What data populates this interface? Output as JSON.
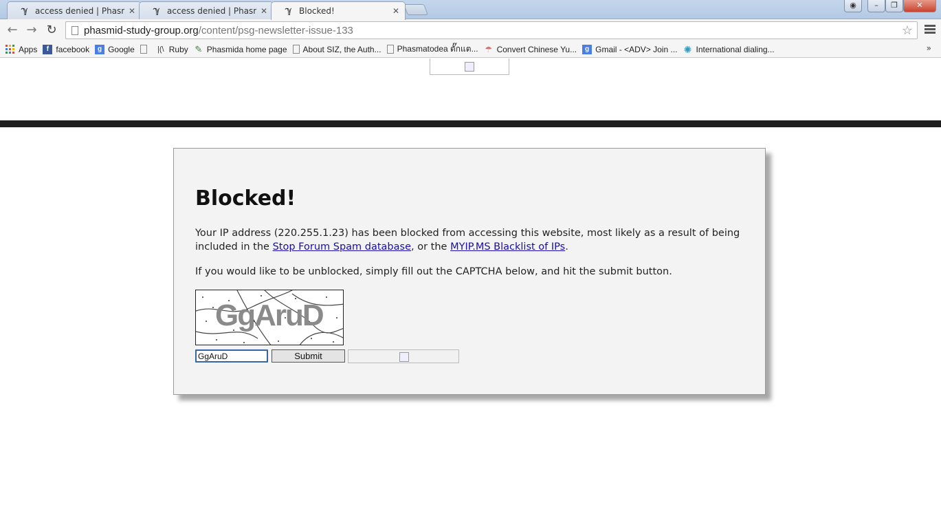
{
  "browser": {
    "tabs": [
      {
        "title": "access denied | Phasmid S",
        "favicon": "fern-icon",
        "active": false
      },
      {
        "title": "access denied | Phasmid S",
        "favicon": "fern-icon",
        "active": false
      },
      {
        "title": "Blocked!",
        "favicon": "fern-icon",
        "active": true
      }
    ],
    "url_host": "phasmid-study-group.org",
    "url_path": "/content/psg-newsletter-issue-133",
    "bookmarks": [
      {
        "label": "Apps",
        "icon": "apps-grid-icon"
      },
      {
        "label": "facebook",
        "icon": "facebook-icon"
      },
      {
        "label": "Google",
        "icon": "google-icon"
      },
      {
        "label": "",
        "icon": "page-icon"
      },
      {
        "label": "Ruby",
        "icon": "ruby-icon"
      },
      {
        "label": "Phasmida home page",
        "icon": "phasmida-icon"
      },
      {
        "label": "About SIZ, the Auth...",
        "icon": "page-icon"
      },
      {
        "label": "Phasmatodea ตั๊กแต...",
        "icon": "page-icon"
      },
      {
        "label": "Convert Chinese Yu...",
        "icon": "mushroom-icon"
      },
      {
        "label": "Gmail - <ADV> Join ...",
        "icon": "google-icon"
      },
      {
        "label": "International dialing...",
        "icon": "globe-icon"
      }
    ],
    "bookmarks_more": "»"
  },
  "page": {
    "heading": "Blocked!",
    "para1_before": "Your IP address (220.255.1.23) has been blocked from accessing this website, most likely as a result of being included in the ",
    "link1": "Stop Forum Spam database",
    "para1_mid": ", or the ",
    "link2": "MYIP.MS Blacklist of IPs",
    "para1_end": ".",
    "para2": "If you would like to be unblocked, simply fill out the CAPTCHA below, and hit the submit button.",
    "captcha_text": "GgAruD",
    "captcha_input_value": "GgAruD",
    "submit_label": "Submit"
  }
}
